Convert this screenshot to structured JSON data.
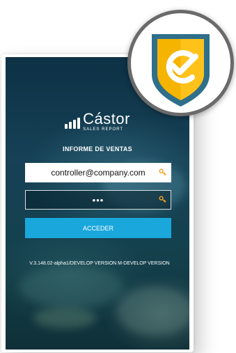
{
  "brand": {
    "name": "Cástor",
    "tagline": "SALES REPORT"
  },
  "login": {
    "heading": "INFORME DE VENTAS",
    "email_value": "controller@company.com",
    "password_value": "•••",
    "submit_label": "ACCEDER",
    "version_text": "V.3.148.02-alpha1/DEVELOP VERSION M-DEVELOP VERSION"
  },
  "icons": {
    "email_field_icon": "key-icon",
    "password_field_icon": "key-icon",
    "badge_icon": "shield-check-icon"
  },
  "colors": {
    "accent": "#1aa7dc",
    "key_icon": "#f0a020",
    "shield_yellow": "#f5b400",
    "shield_border": "#2f6f8a"
  }
}
